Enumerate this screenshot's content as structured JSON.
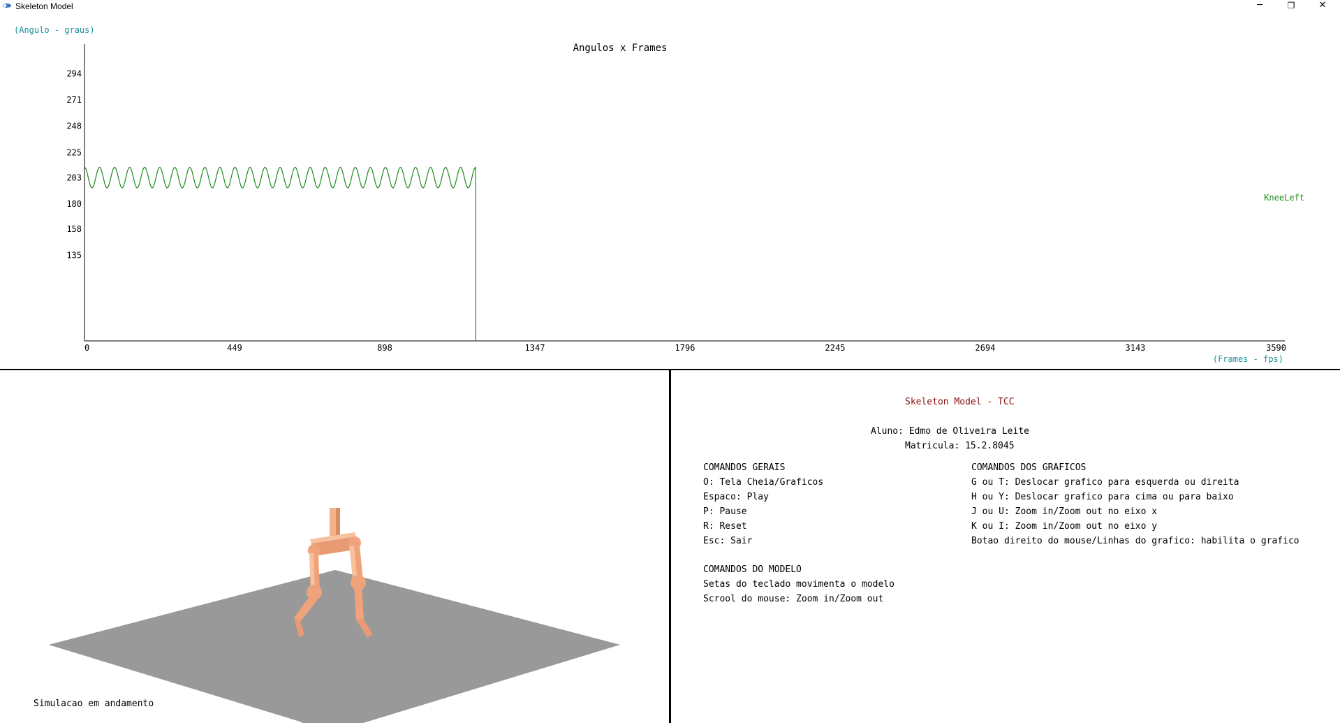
{
  "window": {
    "title": "Skeleton Model",
    "minimize": "─",
    "restore": "❐",
    "close": "✕"
  },
  "chart_data": {
    "type": "line",
    "title": "Angulos x Frames",
    "ylabel": "(Angulo - graus)",
    "xlabel": "(Frames - fps)",
    "x_ticks": [
      "0",
      "449",
      "898",
      "1347",
      "1796",
      "2245",
      "2694",
      "3143",
      "3590"
    ],
    "y_ticks": [
      "135",
      "158",
      "180",
      "203",
      "225",
      "248",
      "271",
      "294"
    ],
    "xlim": [
      0,
      3590
    ],
    "ylim": [
      60,
      320
    ],
    "grid": false,
    "series": [
      {
        "name": "KneeLeft",
        "color": "#1a8a1a",
        "x_start": 0,
        "x_end": 1170,
        "cycles": 26,
        "center": 203,
        "amplitude": 9,
        "drop_to": 60
      }
    ],
    "legend_position": "right"
  },
  "scene": {
    "status": "Simulacao em andamento",
    "floor_color": "#999999",
    "skin_color": "#f0a37a"
  },
  "info": {
    "title": "Skeleton Model - TCC",
    "student": "Aluno: Edmo de Oliveira Leite",
    "registration": "Matricula: 15.2.8045",
    "general_header": "COMANDOS GERAIS",
    "general": [
      "O: Tela Cheia/Graficos",
      "Espaco: Play",
      "P: Pause",
      "R: Reset",
      "Esc: Sair"
    ],
    "charts_header": "COMANDOS DOS GRAFICOS",
    "charts": [
      "G ou T: Deslocar grafico para esquerda ou direita",
      "H ou Y: Deslocar grafico para cima ou para baixo",
      "J ou U: Zoom in/Zoom out no eixo x",
      "K ou I: Zoom in/Zoom out no eixo y",
      "Botao direito do mouse/Linhas do grafico: habilita o grafico"
    ],
    "model_header": "COMANDOS DO MODELO",
    "model": [
      "Setas do teclado movimenta o modelo",
      "Scrool do mouse: Zoom in/Zoom out"
    ]
  }
}
